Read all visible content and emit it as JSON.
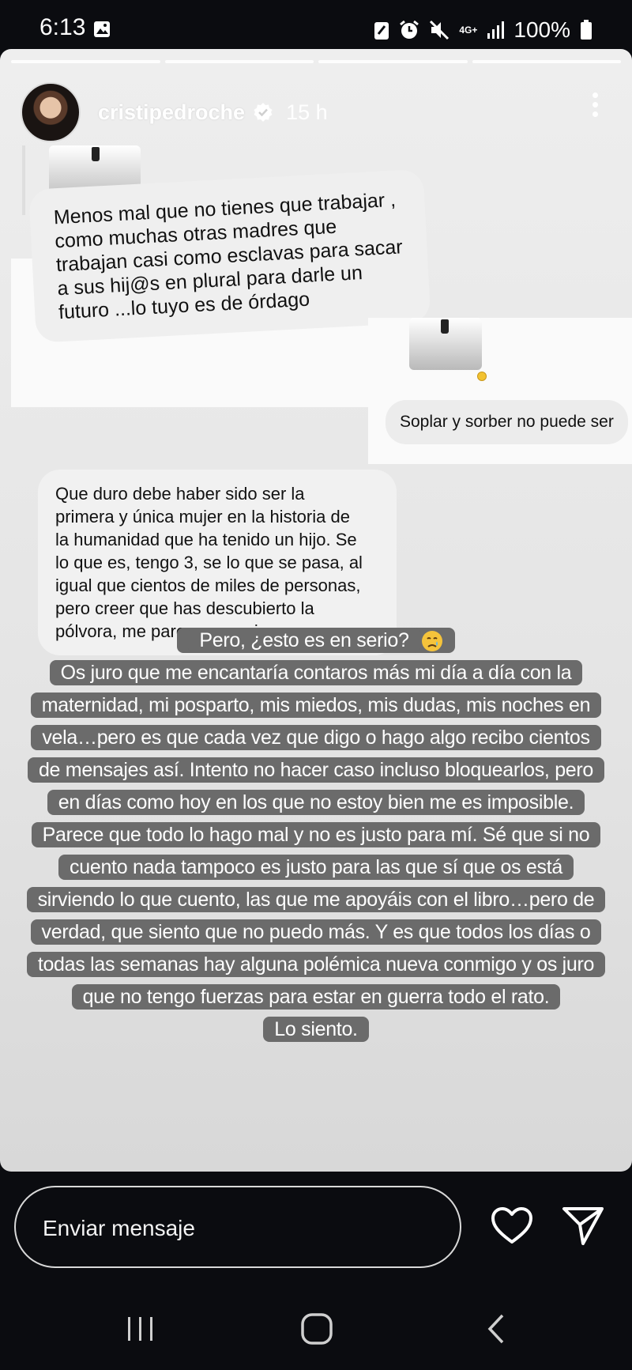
{
  "status_bar": {
    "time": "6:13",
    "network": "4G+",
    "battery": "100%"
  },
  "story": {
    "username": "cristipedroche",
    "time_ago": "15 h",
    "segments": 4
  },
  "comments": {
    "comment1": "Menos mal que no tienes que trabajar ,\ncomo muchas otras madres que\ntrabajan casi como esclavas para sacar\na sus hij@s  en plural para darle un\nfuturo ...lo tuyo es de órdago",
    "comment2": "Soplar y sorber no puede ser",
    "comment3": "Que duro debe haber sido ser la\nprimera y única mujer en la historia de\nla humanidad que ha tenido un hijo. Se\nlo que es, tengo 3, se lo que se pasa, al\nigual que cientos de miles de personas,\npero creer que has descubierto la\npólvora, me parece excesivo."
  },
  "caption": {
    "line1": "Pero, ¿esto es en serio?",
    "line2": "Os juro que me encantaría contaros más mi día a día con la",
    "line3": "maternidad, mi posparto, mis miedos, mis dudas, mis noches en",
    "line4": "vela…pero es que cada vez que digo o hago algo recibo cientos",
    "line5": "de mensajes así. Intento no hacer caso incluso bloquearlos, pero",
    "line6": "en días como hoy en los que no estoy bien me es imposible.",
    "line7": "Parece que todo lo hago mal y no es justo para mí. Sé que si no",
    "line8": "cuento nada tampoco es justo para las que sí que os está",
    "line9": "sirviendo lo que cuento, las que me apoyáis con el libro…pero de",
    "line10": "verdad, que siento que no puedo más. Y es que todos los días o",
    "line11": "todas las semanas hay alguna polémica nueva conmigo y os juro",
    "line12": "que no tengo fuerzas para estar en guerra todo el rato.",
    "line13": "Lo siento."
  },
  "reply_bar": {
    "placeholder": "Enviar mensaje"
  },
  "colors": {
    "caption_bg": "#6b6b6b",
    "background": "#0b0c10",
    "verified": "#ffffff"
  }
}
